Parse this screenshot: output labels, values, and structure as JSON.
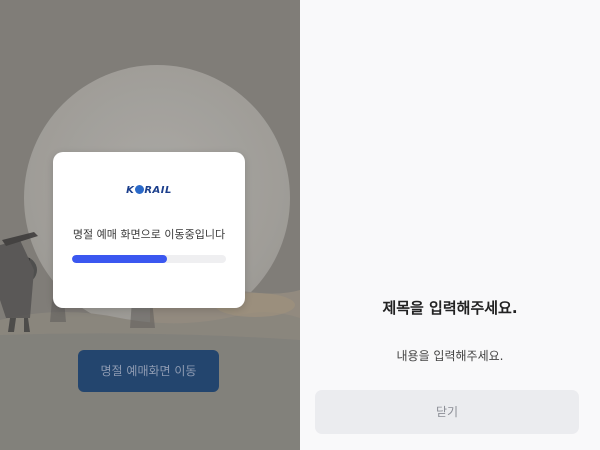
{
  "left_panel": {
    "logo_text_left": "K",
    "logo_text_right": "RAIL",
    "modal_message": "명절 예매 화면으로 이동중입니다",
    "progress_fraction": 0.62,
    "move_button_label": "명절 예매화면 이동",
    "colors": {
      "progress": "#3b57f0",
      "move_button_bg": "#23456e",
      "logo": "#1c3f8c"
    }
  },
  "right_panel": {
    "title": "제목을 입력해주세요.",
    "content": "내용을 입력해주세요.",
    "close_button_label": "닫기"
  }
}
